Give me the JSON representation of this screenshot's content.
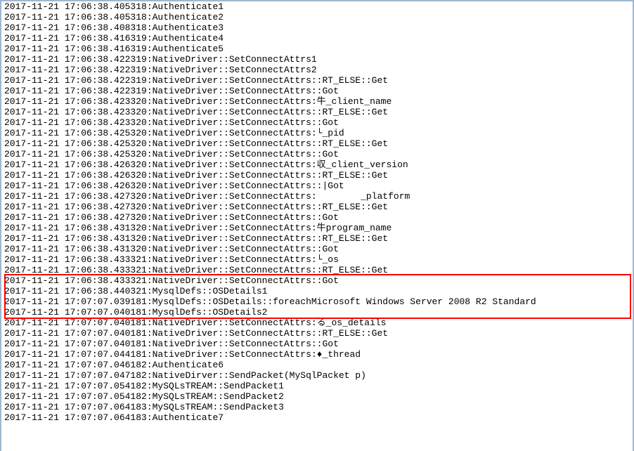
{
  "log_lines": [
    "2017-11-21 17:06:38.405318:Authenticate1",
    "2017-11-21 17:06:38.405318:Authenticate2",
    "2017-11-21 17:06:38.408318:Authenticate3",
    "2017-11-21 17:06:38.416319:Authenticate4",
    "2017-11-21 17:06:38.416319:Authenticate5",
    "2017-11-21 17:06:38.422319:NativeDriver::SetConnectAttrs1",
    "2017-11-21 17:06:38.422319:NativeDriver::SetConnectAttrs2",
    "2017-11-21 17:06:38.422319:NativeDriver::SetConnectAttrs::RT_ELSE::Get",
    "2017-11-21 17:06:38.422319:NativeDriver::SetConnectAttrs::Got",
    "2017-11-21 17:06:38.423320:NativeDriver::SetConnectAttrs:牛_client_name",
    "2017-11-21 17:06:38.423320:NativeDriver::SetConnectAttrs::RT_ELSE::Get",
    "2017-11-21 17:06:38.423320:NativeDriver::SetConnectAttrs::Got",
    "2017-11-21 17:06:38.425320:NativeDriver::SetConnectAttrs:└_pid",
    "2017-11-21 17:06:38.425320:NativeDriver::SetConnectAttrs::RT_ELSE::Get",
    "2017-11-21 17:06:38.425320:NativeDriver::SetConnectAttrs::Got",
    "2017-11-21 17:06:38.426320:NativeDriver::SetConnectAttrs:収_client_version",
    "2017-11-21 17:06:38.426320:NativeDriver::SetConnectAttrs::RT_ELSE::Get",
    "2017-11-21 17:06:38.426320:NativeDriver::SetConnectAttrs::|Got",
    "2017-11-21 17:06:38.427320:NativeDriver::SetConnectAttrs:        _platform",
    "2017-11-21 17:06:38.427320:NativeDriver::SetConnectAttrs::RT_ELSE::Get",
    "2017-11-21 17:06:38.427320:NativeDriver::SetConnectAttrs::Got",
    "2017-11-21 17:06:38.431320:NativeDriver::SetConnectAttrs:牛program_name",
    "2017-11-21 17:06:38.431320:NativeDriver::SetConnectAttrs::RT_ELSE::Get",
    "2017-11-21 17:06:38.431320:NativeDriver::SetConnectAttrs::Got",
    "2017-11-21 17:06:38.433321:NativeDriver::SetConnectAttrs:└_os",
    "2017-11-21 17:06:38.433321:NativeDriver::SetConnectAttrs::RT_ELSE::Get",
    "2017-11-21 17:06:38.433321:NativeDriver::SetConnectAttrs::Got",
    "2017-11-21 17:06:38.440321:MysqlDefs::OSDetails1",
    "2017-11-21 17:07:07.039181:MysqlDefs::OSDetails::foreachMicrosoft Windows Server 2008 R2 Standard",
    "2017-11-21 17:07:07.040181:MysqlDefs::OSDetails2",
    "2017-11-21 17:07:07.040181:NativeDriver::SetConnectAttrs:る_os_details",
    "2017-11-21 17:07:07.040181:NativeDriver::SetConnectAttrs::RT_ELSE::Get",
    "2017-11-21 17:07:07.040181:NativeDriver::SetConnectAttrs::Got",
    "2017-11-21 17:07:07.044181:NativeDriver::SetConnectAttrs:♦_thread",
    "2017-11-21 17:07:07.046182:Authenticate6",
    "2017-11-21 17:07:07.047182:NativeDirver::SendPacket(MySqlPacket p)",
    "2017-11-21 17:07:07.054182:MySQLsTREAM::SendPacket1",
    "2017-11-21 17:07:07.054182:MySQLsTREAM::SendPacket2",
    "2017-11-21 17:07:07.064183:MySQLsTREAM::SendPacket3",
    "2017-11-21 17:07:07.064183:Authenticate7"
  ],
  "highlight": {
    "start_index": 26,
    "end_index": 29
  }
}
